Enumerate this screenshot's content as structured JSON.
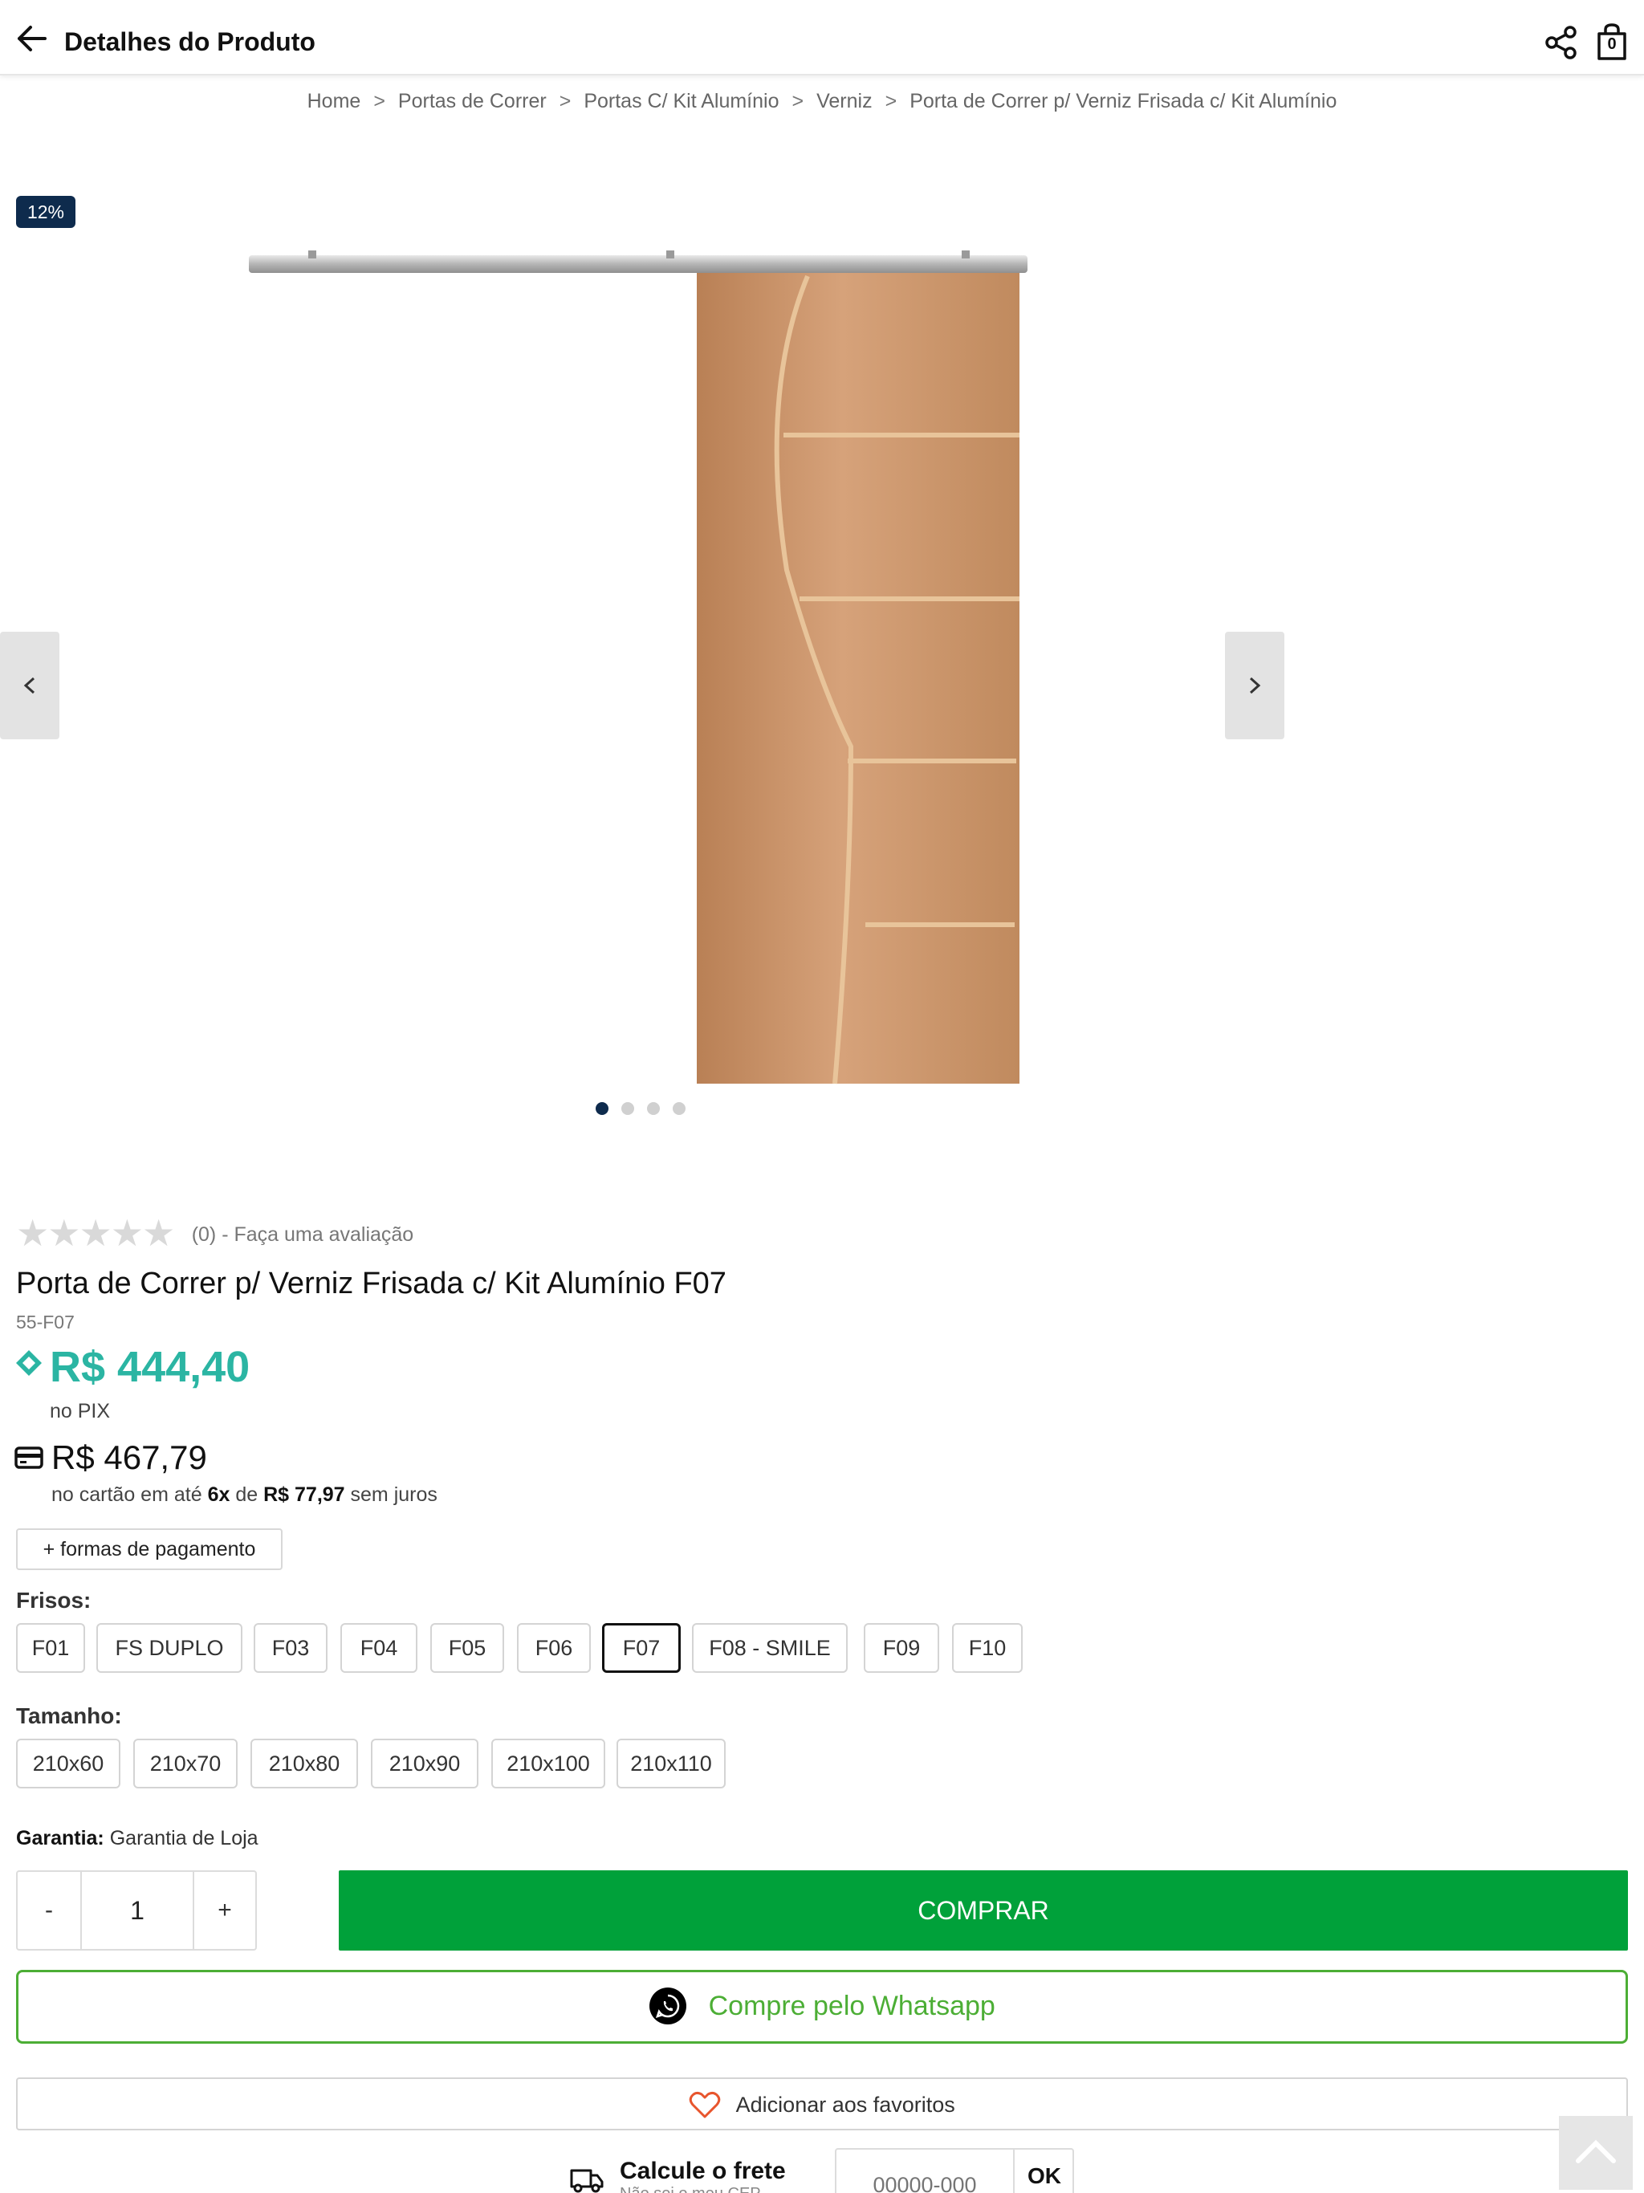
{
  "header": {
    "title": "Detalhes do Produto",
    "cart_count": "0"
  },
  "breadcrumb": [
    "Home",
    "Portas de Correr",
    "Portas C/ Kit Alumínio",
    "Verniz",
    "Porta de Correr p/ Verniz Frisada c/ Kit Alumínio"
  ],
  "breadcrumb_separator": ">",
  "gallery": {
    "discount_badge": "12%",
    "image_count": 4,
    "active_index": 0
  },
  "product": {
    "rating_text": "(0) - Faça uma avaliação",
    "title": "Porta de Correr p/ Verniz Frisada c/ Kit Alumínio F07",
    "sku": "55-F07",
    "pix_price": "R$ 444,40",
    "pix_label": "no PIX",
    "card_price": "R$ 467,79",
    "installments": {
      "prefix": "no cartão em até",
      "count": "6x",
      "middle": "de",
      "value": "R$ 77,97",
      "suffix": "sem juros"
    },
    "payment_methods_label": "+ formas de pagamento"
  },
  "frisos": {
    "label": "Frisos:",
    "options": [
      "F01",
      "FS DUPLO",
      "F03",
      "F04",
      "F05",
      "F06",
      "F07",
      "F08 - SMILE",
      "F09",
      "F10"
    ],
    "selected": "F07"
  },
  "tamanho": {
    "label": "Tamanho:",
    "options": [
      "210x60",
      "210x70",
      "210x80",
      "210x90",
      "210x100",
      "210x110"
    ]
  },
  "warranty": {
    "label": "Garantia:",
    "value": "Garantia de Loja"
  },
  "quantity": {
    "minus": "-",
    "value": "1",
    "plus": "+"
  },
  "actions": {
    "buy_label": "COMPRAR",
    "whatsapp_label": "Compre pelo Whatsapp",
    "favorite_label": "Adicionar aos favoritos"
  },
  "freight": {
    "title": "Calcule o frete",
    "subtitle": "Não sei o meu CEP",
    "placeholder": "00000-000",
    "ok_label": "OK"
  },
  "colors": {
    "accent_green": "#00a13a",
    "pix_teal": "#2bb5a3",
    "whatsapp_green": "#4cae35",
    "badge_navy": "#0e2b4d"
  },
  "icons": [
    "back-arrow-icon",
    "share-icon",
    "shopping-bag-icon",
    "chevron-left-icon",
    "chevron-right-icon",
    "star-icon",
    "pix-icon",
    "credit-card-icon",
    "whatsapp-icon",
    "heart-icon",
    "truck-icon",
    "chevron-up-icon"
  ]
}
